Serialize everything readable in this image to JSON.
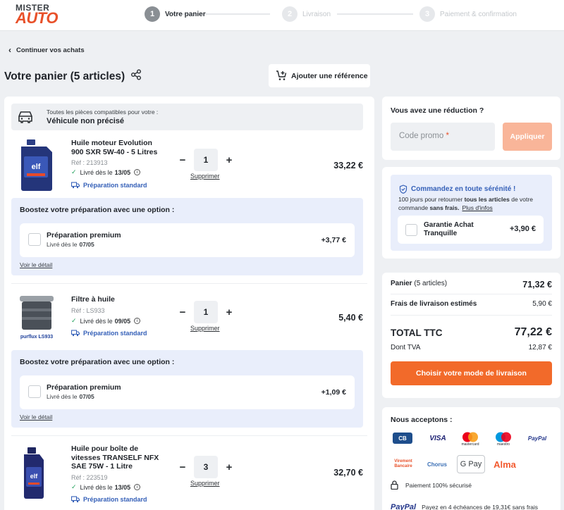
{
  "brand": {
    "line1": "MISTER",
    "line2": "AUTO"
  },
  "steps": [
    {
      "num": "1",
      "label": "Votre panier"
    },
    {
      "num": "2",
      "label": "Livraison"
    },
    {
      "num": "3",
      "label": "Paiement & confirmation"
    }
  ],
  "nav": {
    "back_label": "Continuer vos achats"
  },
  "cart": {
    "title": "Votre panier (5 articles)",
    "add_reference": "Ajouter une référence",
    "vehicle_line1": "Toutes les pièces compatibles pour votre :",
    "vehicle_line2": "Véhicule non précisé",
    "remove_label": "Supprimer",
    "boost_title": "Boostez votre préparation avec une option :",
    "premium_name": "Préparation premium",
    "premium_delivery_prefix": "Livré dès le",
    "see_detail": "Voir le détail",
    "delivery_prefix": "Livré dès le",
    "prep_standard": "Préparation standard",
    "items": [
      {
        "name": "Huile moteur Evolution 900 SXR 5W-40 - 5 Litres",
        "ref": "Réf : 213913",
        "delivery_date": "13/05",
        "qty": "1",
        "price": "33,22 €",
        "premium_date": "07/05",
        "premium_price": "+3,77 €",
        "image_label": "elf"
      },
      {
        "name": "Filtre à huile",
        "ref": "Réf : LS933",
        "delivery_date": "09/05",
        "qty": "1",
        "price": "5,40 €",
        "premium_date": "07/05",
        "premium_price": "+1,09 €",
        "image_label": "purflux LS933"
      },
      {
        "name": "Huile pour boîte de vitesses TRANSELF NFX SAE 75W - 1 Litre",
        "ref": "Réf : 223519",
        "delivery_date": "13/05",
        "qty": "3",
        "price": "32,70 €",
        "image_label": "elf"
      }
    ]
  },
  "promo": {
    "title": "Vous avez une réduction ?",
    "placeholder": "Code promo",
    "required_mark": "*",
    "apply": "Appliquer"
  },
  "serenity": {
    "title": "Commandez en toute sérénité !",
    "desc_a": "100 jours pour retourner",
    "desc_b": "tous les articles",
    "desc_c": "de votre commande",
    "desc_d": "sans frais.",
    "more": "Plus d'infos",
    "guarantee_name": "Garantie Achat Tranquille",
    "guarantee_price": "+3,90 €"
  },
  "summary": {
    "panier_label": "Panier",
    "panier_count": "(5 articles)",
    "panier_value": "71,32 €",
    "shipping_label": "Frais de livraison estimés",
    "shipping_value": "5,90 €",
    "total_label": "TOTAL TTC",
    "total_value": "77,22 €",
    "tva_label": "Dont TVA",
    "tva_value": "12,87 €",
    "cta": "Choisir votre mode de livraison"
  },
  "payment": {
    "title": "Nous acceptons :",
    "methods": [
      "CB",
      "VISA",
      "mastercard",
      "maestro",
      "PayPal",
      "Virement Bancaire",
      "Chorus",
      "G Pay",
      "Alma"
    ],
    "secure": "Paiement 100% sécurisé",
    "paypal_brand": "PayPal",
    "paypal_text": "Payez en 4 échéances de 19,31€ sans frais"
  },
  "colors": {
    "accent": "#f26a2a",
    "brand": "#e8512a",
    "link": "#3560b8"
  }
}
